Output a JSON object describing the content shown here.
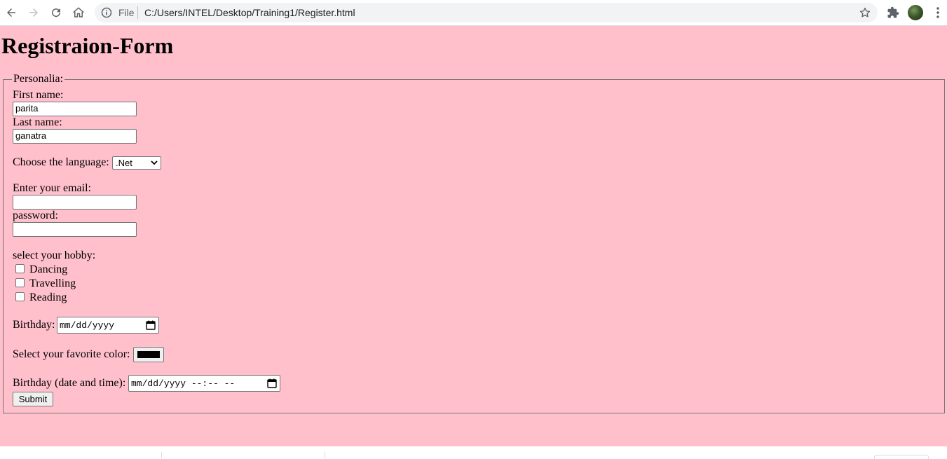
{
  "browser": {
    "omnibox_scheme_label": "File",
    "url": "C:/Users/INTEL/Desktop/Training1/Register.html",
    "icons": [
      "back-arrow-icon",
      "forward-arrow-icon",
      "reload-icon",
      "home-icon",
      "info-icon",
      "star-icon",
      "puzzle-icon",
      "avatar",
      "kebab-menu-icon"
    ]
  },
  "page": {
    "background_color": "#ffc0cb",
    "heading": "Registraion-Form",
    "legend": "Personalia:",
    "first_name_label": "First name:",
    "first_name_value": "parita",
    "last_name_label": "Last name:",
    "last_name_value": "ganatra",
    "language_label": "Choose the language:",
    "language_selected": ".Net",
    "email_label": "Enter your email:",
    "email_value": "",
    "password_label": "password:",
    "password_value": "",
    "hobby_label": "select your hobby:",
    "hobbies": [
      {
        "label": "Dancing",
        "checked": false
      },
      {
        "label": "Travelling",
        "checked": false
      },
      {
        "label": "Reading",
        "checked": false
      }
    ],
    "birthday_label": "Birthday:",
    "birthday_placeholder": "mm/dd/yyyy",
    "color_label": "Select your favorite color:",
    "favorite_color": "#000000",
    "datetime_label": "Birthday (date and time):",
    "datetime_placeholder": "mm/dd/yyyy --:-- --",
    "submit_label": "Submit"
  }
}
